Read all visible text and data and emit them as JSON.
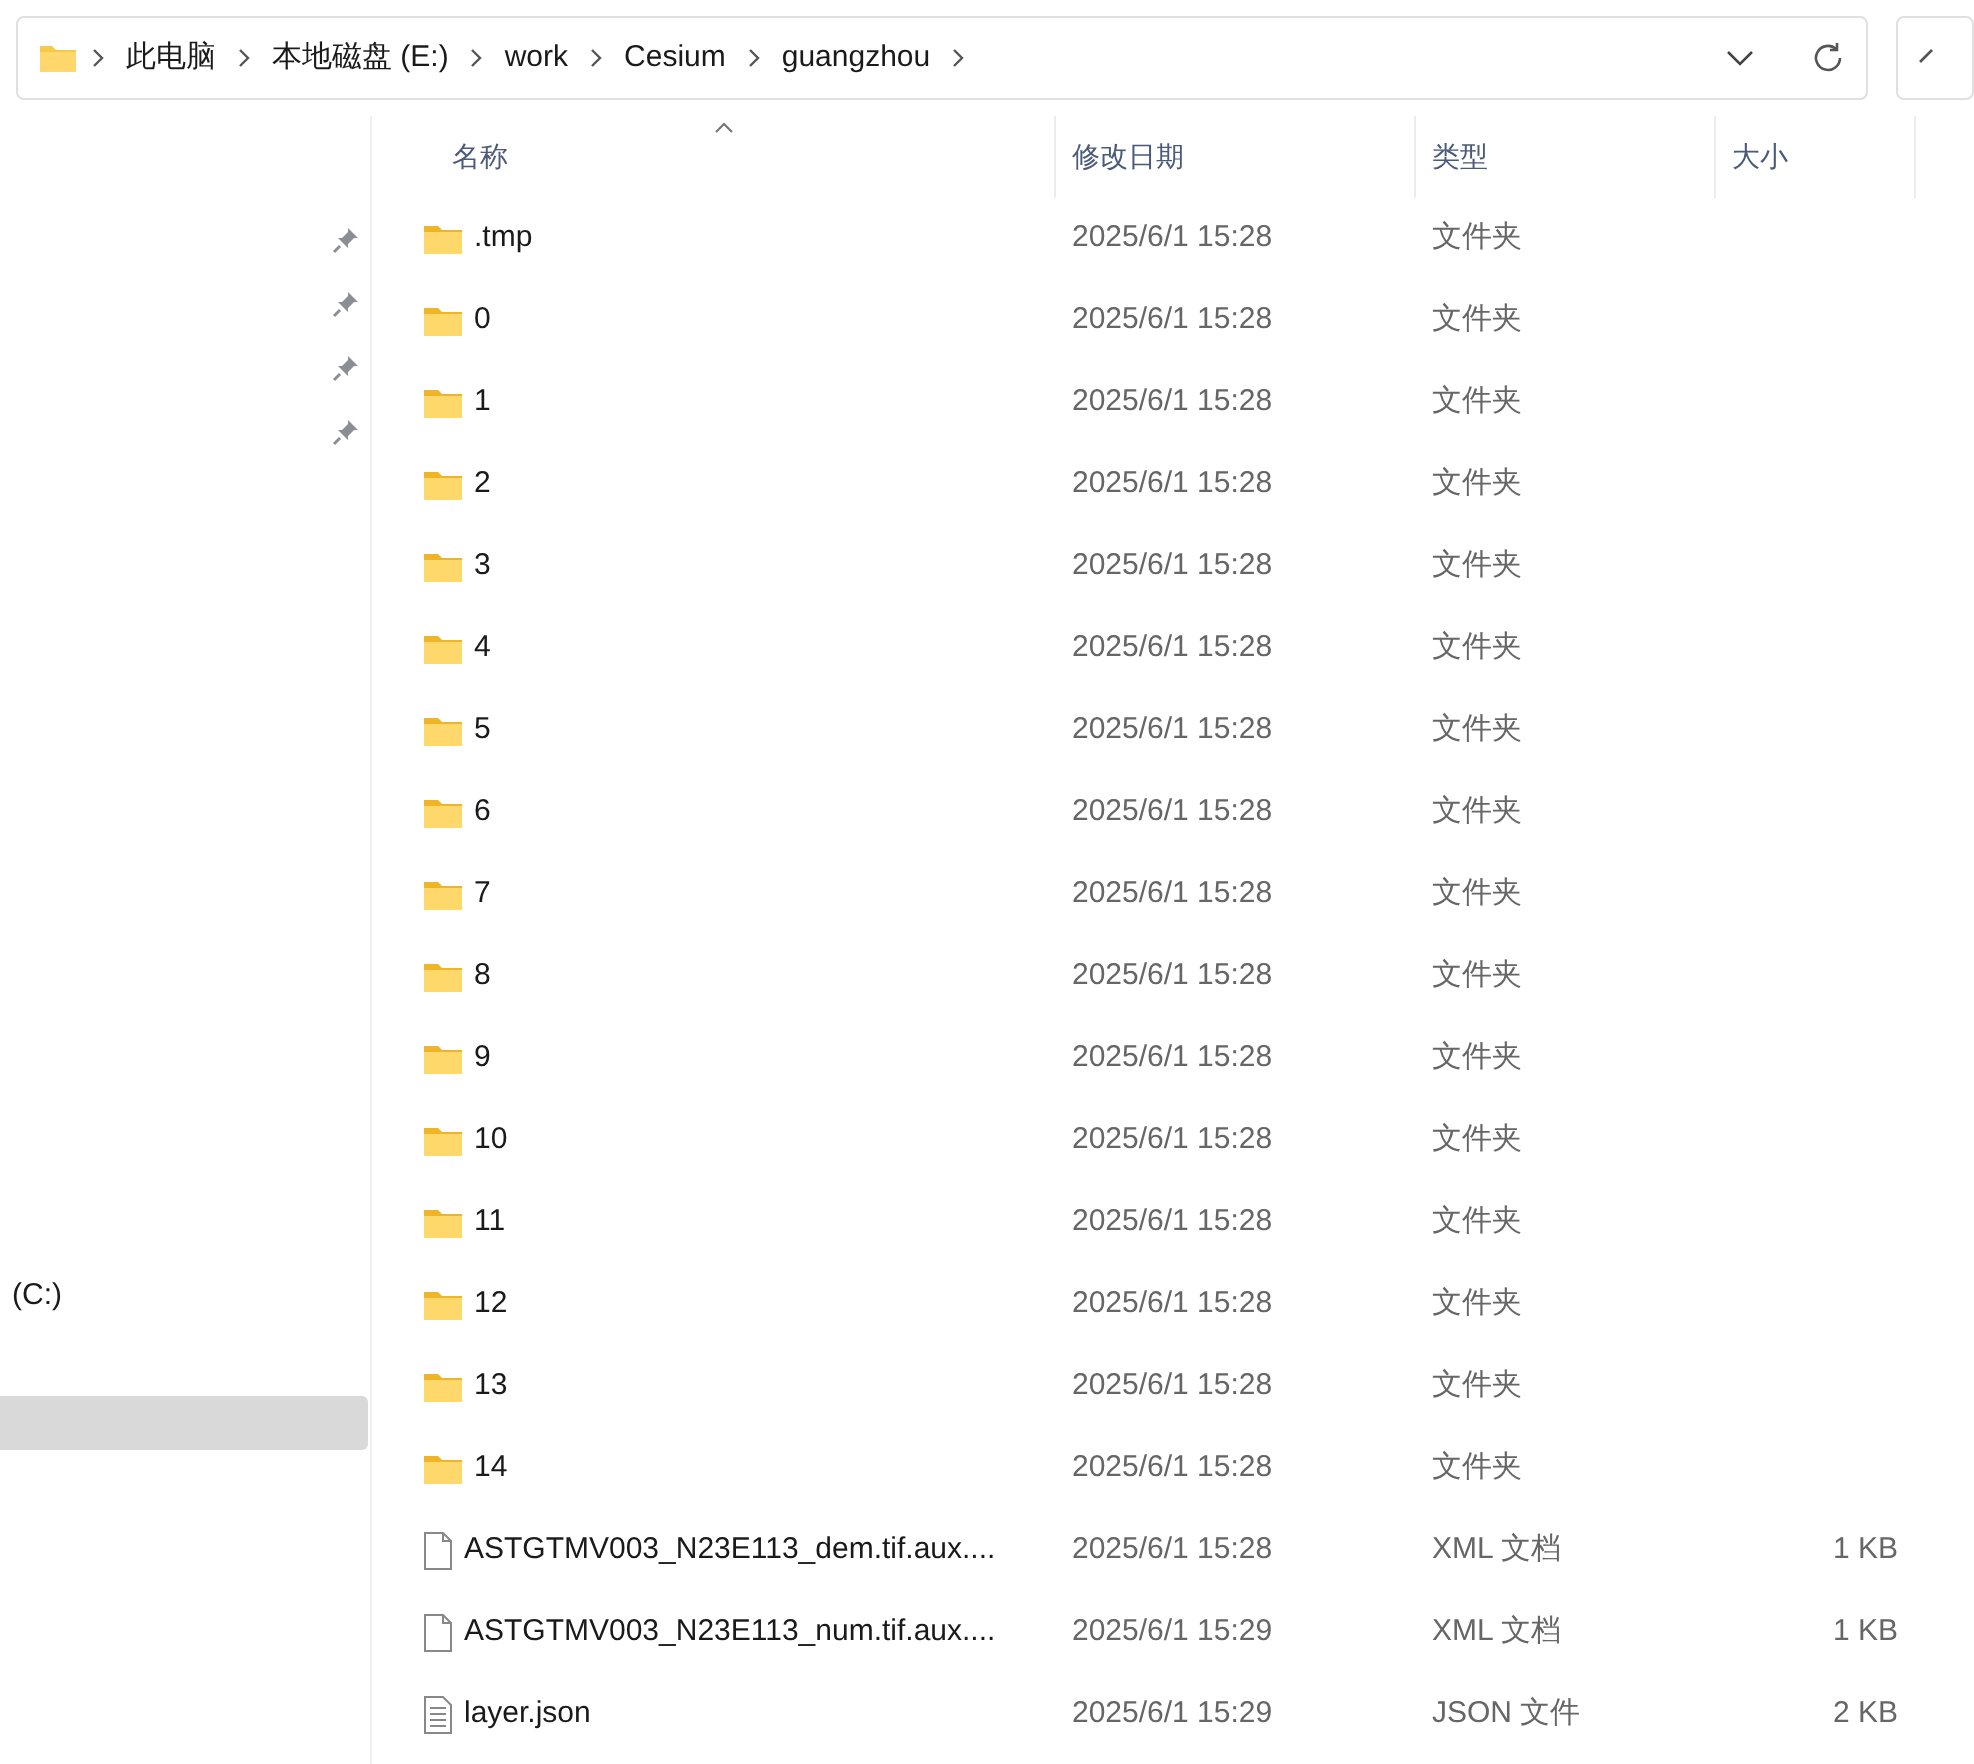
{
  "address_bar": {
    "path": [
      "此电脑",
      "本地磁盘 (E:)",
      "work",
      "Cesium",
      "guangzhou"
    ]
  },
  "sidebar": {
    "items": [
      {
        "pinned": true,
        "selected": false
      },
      {
        "pinned": true,
        "selected": false
      },
      {
        "pinned": true,
        "selected": false
      },
      {
        "pinned": true,
        "selected": false
      },
      {
        "label": "(C:)",
        "pinned": false,
        "selected": false
      },
      {
        "pinned": false,
        "selected": true
      }
    ]
  },
  "columns": [
    {
      "label": "名称",
      "sorted": true
    },
    {
      "label": "修改日期",
      "sorted": false
    },
    {
      "label": "类型",
      "sorted": false
    },
    {
      "label": "大小",
      "sorted": false
    }
  ],
  "files": [
    {
      "kind": "folder",
      "name": ".tmp",
      "date": "2025/6/1 15:28",
      "type": "文件夹"
    },
    {
      "kind": "folder",
      "name": "0",
      "date": "2025/6/1 15:28",
      "type": "文件夹"
    },
    {
      "kind": "folder",
      "name": "1",
      "date": "2025/6/1 15:28",
      "type": "文件夹"
    },
    {
      "kind": "folder",
      "name": "2",
      "date": "2025/6/1 15:28",
      "type": "文件夹"
    },
    {
      "kind": "folder",
      "name": "3",
      "date": "2025/6/1 15:28",
      "type": "文件夹"
    },
    {
      "kind": "folder",
      "name": "4",
      "date": "2025/6/1 15:28",
      "type": "文件夹"
    },
    {
      "kind": "folder",
      "name": "5",
      "date": "2025/6/1 15:28",
      "type": "文件夹"
    },
    {
      "kind": "folder",
      "name": "6",
      "date": "2025/6/1 15:28",
      "type": "文件夹"
    },
    {
      "kind": "folder",
      "name": "7",
      "date": "2025/6/1 15:28",
      "type": "文件夹"
    },
    {
      "kind": "folder",
      "name": "8",
      "date": "2025/6/1 15:28",
      "type": "文件夹"
    },
    {
      "kind": "folder",
      "name": "9",
      "date": "2025/6/1 15:28",
      "type": "文件夹"
    },
    {
      "kind": "folder",
      "name": "10",
      "date": "2025/6/1 15:28",
      "type": "文件夹"
    },
    {
      "kind": "folder",
      "name": "11",
      "date": "2025/6/1 15:28",
      "type": "文件夹"
    },
    {
      "kind": "folder",
      "name": "12",
      "date": "2025/6/1 15:28",
      "type": "文件夹"
    },
    {
      "kind": "folder",
      "name": "13",
      "date": "2025/6/1 15:28",
      "type": "文件夹"
    },
    {
      "kind": "folder",
      "name": "14",
      "date": "2025/6/1 15:28",
      "type": "文件夹"
    },
    {
      "kind": "file",
      "name": "ASTGTMV003_N23E113_dem.tif.aux....",
      "date": "2025/6/1 15:28",
      "type": "XML 文档",
      "size": "1 KB"
    },
    {
      "kind": "file",
      "name": "ASTGTMV003_N23E113_num.tif.aux....",
      "date": "2025/6/1 15:29",
      "type": "XML 文档",
      "size": "1 KB"
    },
    {
      "kind": "text",
      "name": "layer.json",
      "date": "2025/6/1 15:29",
      "type": "JSON 文件",
      "size": "2 KB"
    }
  ]
}
